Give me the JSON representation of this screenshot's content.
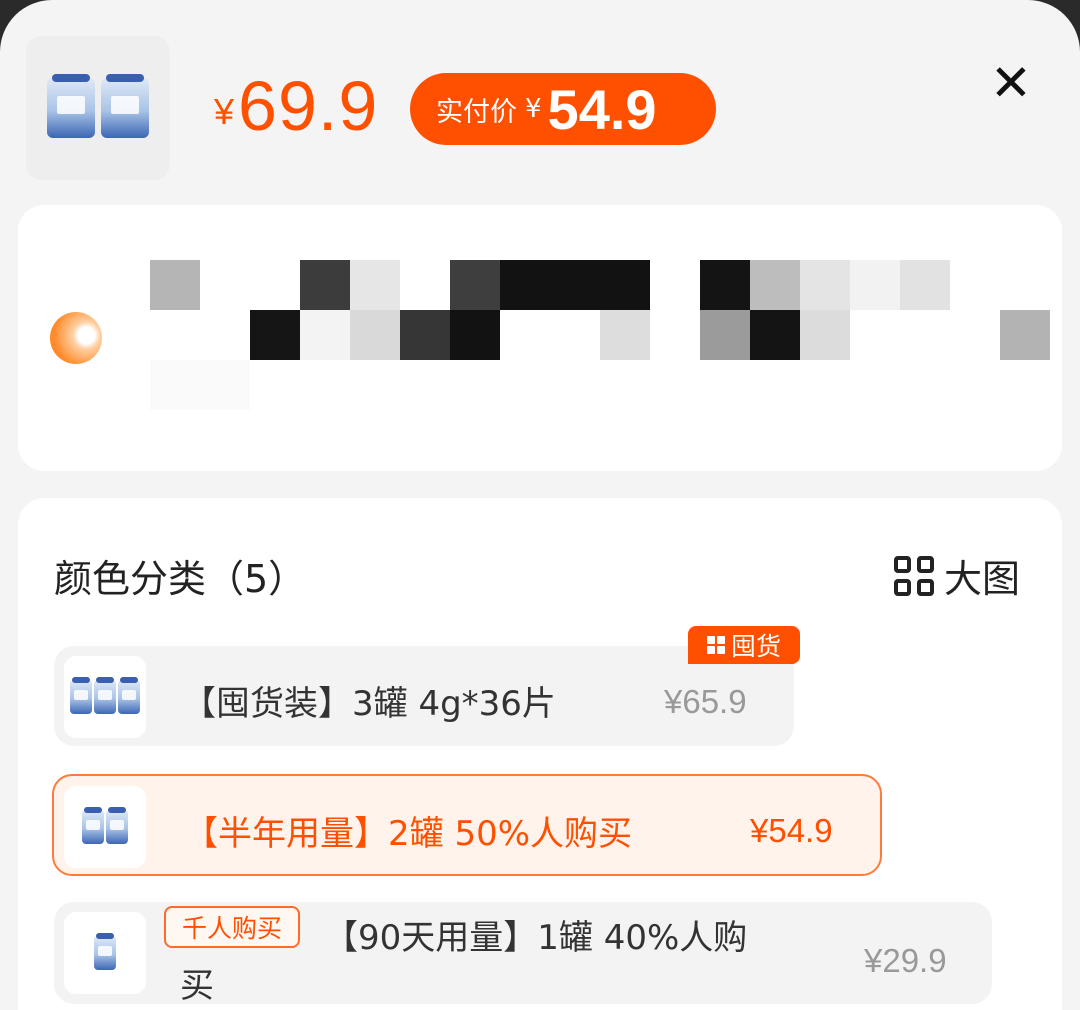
{
  "header": {
    "currency": "¥",
    "original_price": "69.9",
    "pay_label": "实付价",
    "pay_price": "54.9",
    "close_icon": "close-icon",
    "product_image": "product-jars-image"
  },
  "spec_section": {
    "title": "颜色分类（5）",
    "bigpic_label": "大图",
    "bigpic_icon": "grid-icon",
    "options": [
      {
        "label": "【囤货装】3罐 4g*36片",
        "price": "¥65.9",
        "tag": "囤货",
        "selected": false
      },
      {
        "label": "【半年用量】2罐 50%人购买",
        "price": "¥54.9",
        "selected": true
      },
      {
        "label_line1": "【90天用量】1罐 40%人购",
        "label_line2": "买",
        "price": "¥29.9",
        "tag": "千人购买",
        "selected": false
      }
    ]
  },
  "colors": {
    "accent": "#ff5000",
    "selected_bg": "#fff3ec",
    "option_bg": "#f3f3f3"
  }
}
